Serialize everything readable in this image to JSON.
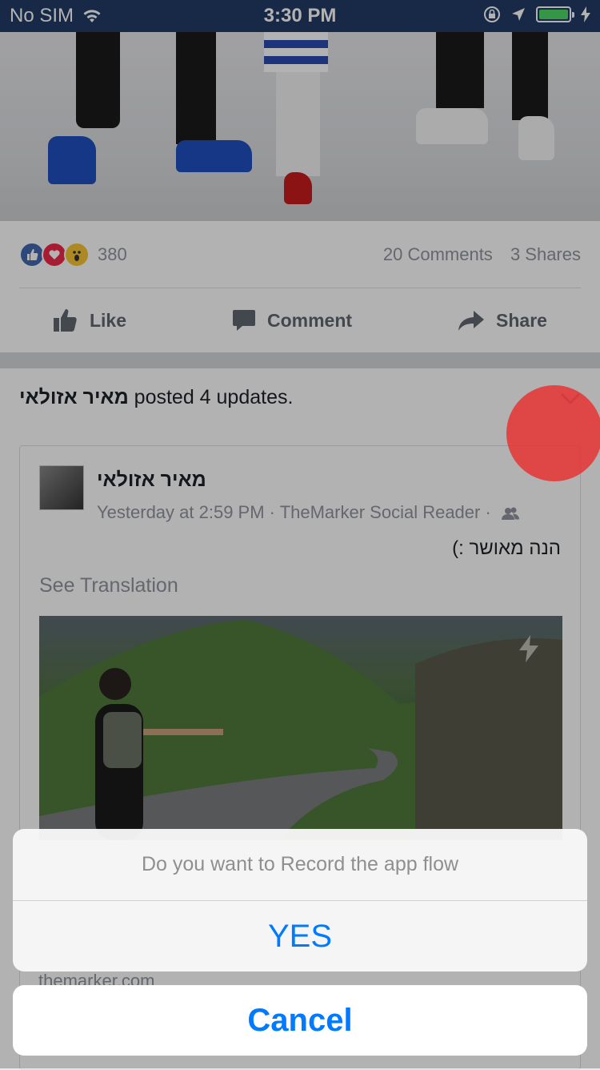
{
  "status_bar": {
    "carrier": "No SIM",
    "time": "3:30 PM",
    "battery_level": 1.0
  },
  "story": {
    "reaction_count": "380",
    "comments": "20 Comments",
    "shares": "3 Shares",
    "actions": {
      "like": "Like",
      "comment": "Comment",
      "share": "Share"
    }
  },
  "post": {
    "header_name": "מאיר אזולאי",
    "header_suffix": "posted 4 updates.",
    "author": "מאיר אזולאי",
    "meta": "Yesterday at 2:59 PM · TheMarker Social Reader ·",
    "text": "הנה מאושר :)",
    "see_translation": "See Translation",
    "link_domain": "themarker.com"
  },
  "action_sheet": {
    "title": "Do you want to Record the app flow",
    "yes_label": "YES",
    "cancel_label": "Cancel"
  },
  "colors": {
    "status_bar": "#213b66",
    "ios_blue": "#007aff",
    "record_dot": "#e63232",
    "battery": "#4cd964"
  }
}
